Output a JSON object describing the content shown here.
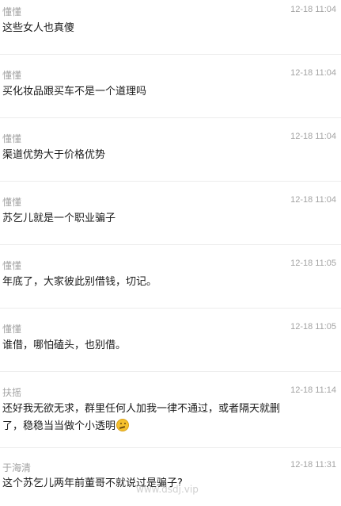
{
  "comments": [
    {
      "user": "懂懂",
      "time": "12-18 11:04",
      "text": "这些女人也真傻"
    },
    {
      "user": "懂懂",
      "time": "12-18 11:04",
      "text": "买化妆品跟买车不是一个道理吗"
    },
    {
      "user": "懂懂",
      "time": "12-18 11:04",
      "text": "渠道优势大于价格优势"
    },
    {
      "user": "懂懂",
      "time": "12-18 11:04",
      "text": "苏乞儿就是一个职业骗子"
    },
    {
      "user": "懂懂",
      "time": "12-18 11:05",
      "text": "年底了，大家彼此别借钱，切记。"
    },
    {
      "user": "懂懂",
      "time": "12-18 11:05",
      "text": "谁借，哪怕磕头，也别借。"
    },
    {
      "user": "扶摇",
      "time": "12-18 11:14",
      "text_line1": "还好我无欲无求，群里任何人加我一律不通过，或者隔天就删",
      "text_line2": "了，稳稳当当做个小透明",
      "emoji": "thinking-emoji-icon"
    },
    {
      "user": "于海清",
      "time": "12-18 11:31",
      "text": "这个苏乞儿两年前董哥不就说过是骗子?"
    }
  ],
  "watermark": "www.dsdj.vip"
}
